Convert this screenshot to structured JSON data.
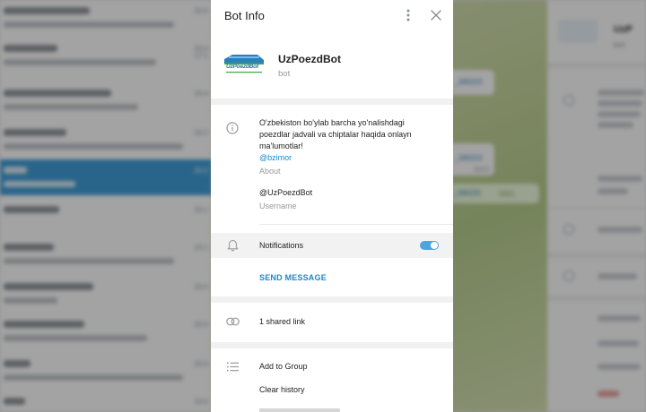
{
  "modal": {
    "title": "Bot Info",
    "profile": {
      "name": "UzPoezdBot",
      "status": "bot",
      "avatar_text": "UzPoezdBot"
    },
    "about": {
      "text": "O'zbekiston bo'ylab barcha yo'nalishdagi\npoezdlar jadvali va chiptalar haqida onlayn\nma'lumotlar!",
      "mention": "@bzimor",
      "caption": "About"
    },
    "username": {
      "value": "@UzPoezdBot",
      "caption": "Username"
    },
    "notifications": {
      "label": "Notifications",
      "enabled": true
    },
    "send_message_label": "SEND MESSAGE",
    "shared_links_label": "1 shared link",
    "actions": [
      {
        "label": "Add to Group"
      },
      {
        "label": "Clear history"
      }
    ]
  },
  "colors": {
    "accent": "#168acd",
    "toggle_on": "#4ea4dc",
    "selected_chat": "#419fd9"
  },
  "background": {
    "chat_times": [
      "20:5",
      "20:4",
      "17:1",
      "20:4",
      "20:2",
      "20:2",
      "20:1",
      "20:1",
      "20:0",
      "20:0",
      "20:0",
      "19:5"
    ],
    "link_snippets": [
      "_180223",
      "_180223",
      "0_180223"
    ],
    "bubble_years": [
      "2021",
      "2021",
      "2021"
    ],
    "right_title": "UzP",
    "right_sub": "bot"
  }
}
